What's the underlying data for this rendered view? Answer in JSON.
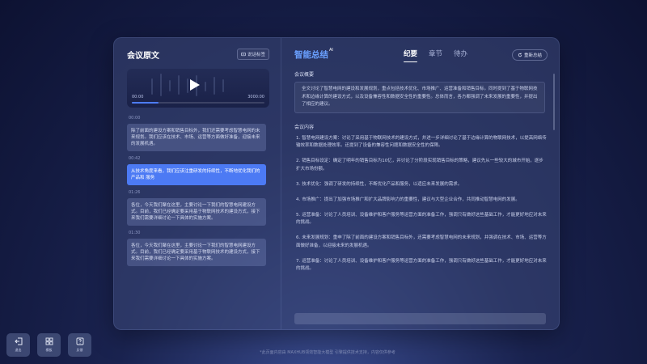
{
  "left_panel": {
    "title": "会议原文",
    "action_label": "说话标签",
    "player": {
      "current_time": "00:00",
      "total_time": "3000:00",
      "progress": 0.2
    },
    "segments": [
      {
        "time": "00:00",
        "text": "除了前面的建设方案和销售目标外，我们还需要考虑智慧电网的未来规划。我们应该在技术、市场、运营等方面做好准备，迎接未来的发展机遇。",
        "active": false
      },
      {
        "time": "00:42",
        "text": "从技术角度来看，我们应该注重研发的持续性，不断地优化我们的产品和 服务",
        "active": true
      },
      {
        "time": "01:26",
        "text": "各位，今天我们聚在这里，主要讨论一下我们的智慧电网建设方式。目前，我们已经确定要采用基于物联网技术的建设方式，接下来我们需要详细讨论一下具体的实施方案。",
        "active": false
      },
      {
        "time": "01:30",
        "text": "各位，今天我们聚在这里，主要讨论一下我们的智慧电网建设方式。目前，我们已经确定要采用基于物联网技术的建设方式，接下来我们需要详细讨论一下具体的实施方案。",
        "active": false
      }
    ]
  },
  "right_panel": {
    "title": "智能总结",
    "ai_badge": "AI",
    "tabs": [
      "纪要",
      "章节",
      "待办"
    ],
    "active_tab": "纪要",
    "regenerate_label": "重新总结",
    "overview_title": "会议概要",
    "overview_text": "全文讨论了智慧电网的建设和发展规划，重点包括技术优化、市场推广、运营准备和销售目标。同时提到了基于物联网技术和边缘计算的建设方式，以及设备兼容性和数据安全性的重要性。总体而言，各方都强调了未来发展的重要性，并提出了相应的建议。",
    "content_title": "会议内容",
    "content_items": [
      {
        "num": "1.",
        "text": "智慧电网建设方案：讨论了采用基于物联网技术的建设方式，并进一步详细讨论了基于边缘计算的物联网技术，以提高网络传输效率和数据处理效率。还提到了设备的兼容性问题和数据安全性的保障。"
      },
      {
        "num": "2.",
        "text": "销售目标设定：确定了明年的销售目标为10亿，并讨论了分阶段实现销售目标的策略，建议先从一些较大的城市开始，逐步扩大市场份额。"
      },
      {
        "num": "3.",
        "text": "技术优化：强调了研发的持续性，不断优化产品和服务，以适应未来发展的需求。"
      },
      {
        "num": "4.",
        "text": "市场推广：提出了加强市场推广和扩大品牌影响力的重要性，建议与大型企业合作，共同推动智慧电网的发展。"
      },
      {
        "num": "5.",
        "text": "运营准备：讨论了人员培训、设备维护和客户服务等运营方面的准备工作，强调只有做好这些基础工作，才能更好地应对未来的挑战。"
      },
      {
        "num": "6.",
        "text": "未来发展规划：重申了除了前面的建设方案和销售目标外，还需要考虑智慧电网的未来规划，并强调在技术、市场、运营等方面做好准备，以迎接未来的发展机遇。"
      },
      {
        "num": "7.",
        "text": "运营准备：讨论了人员培训、设备维护和客户服务等运营方面的准备工作，强调只有做好这些基础工作，才能更好地应对未来的挑战。"
      }
    ]
  },
  "dock": [
    {
      "label": "退出",
      "icon": "exit-icon"
    },
    {
      "label": "模板",
      "icon": "grid-icon"
    },
    {
      "label": "反馈",
      "icon": "help-icon"
    }
  ],
  "footer_text": "*此页面内容由 MAXHUB领效智能大模型 引擎提供技术支持，内容仅供参考",
  "colors": {
    "accent": "#4c7af4",
    "summary_title": "#6aa0ff"
  }
}
